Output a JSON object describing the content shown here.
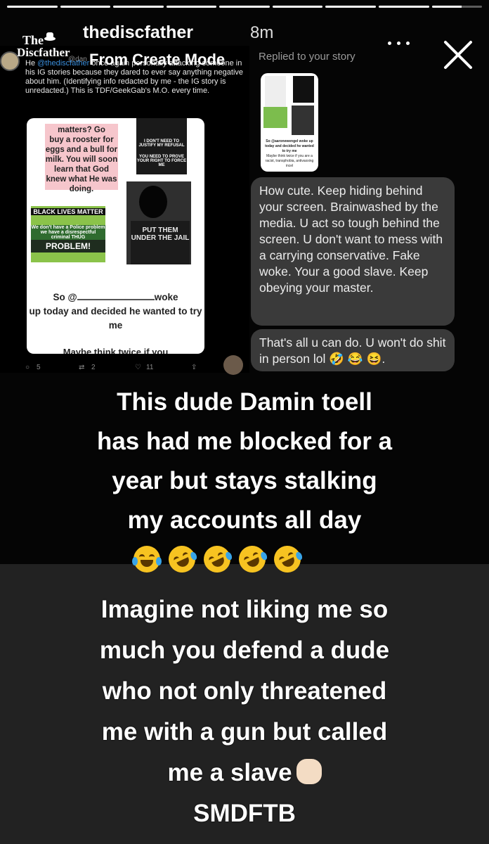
{
  "progress": {
    "segments": [
      1,
      1,
      1,
      1,
      1,
      1,
      1,
      1,
      0.6
    ]
  },
  "header": {
    "logo_line1": "The",
    "logo_line2": "Discfather",
    "username": "thediscfather",
    "time": "8m",
    "subtitle": "From Create Mode",
    "more_icon": "more-horizontal-icon",
    "close_icon": "close-icon"
  },
  "tweet": {
    "handle": "@dan",
    "text_prefix": "He ",
    "mention": "@thediscfather",
    "text_body": " once again personally attacking someone in his IG stories because they dared to ever say anything negative about him. (Identifying info redacted by me - the IG story is unredacted.) This is TDF/GeekGab's M.O. every time.",
    "note_top": "matters? Go",
    "note_text": "buy a rooster for eggs and a bull for milk. You will soon learn that God knew what He was doing.",
    "meme_text1": "I DON'T NEED TO JUSTIFY MY REFUSAL",
    "meme_text2": "YOU NEED TO PROVE YOUR RIGHT TO FORCE ME",
    "blm_title": "BLACK LIVES MATTER",
    "blm_sub": "We don't have a Police problem we have a disrespectful criminal THUG",
    "blm_problem": "PROBLEM!",
    "shirt_text": "PUT THEM UNDER THE JAIL",
    "caption_prefix": "So @",
    "caption_suffix": "woke",
    "caption_rest": "up today and decided he wanted to try me",
    "caption_cut": "Maybe think twice if you",
    "replies": "5",
    "retweets": "2",
    "likes": "11"
  },
  "dm": {
    "replied_label": "Replied to your story",
    "thumb_caption": "So @aaronewengel woke up today and decided he wanted to try me",
    "thumb_caption2": "Maybe think twice if you are a racist, transphobia, antivaxxing incel",
    "message1": "How cute. Keep hiding behind your screen. Brainwashed by the media. U act so tough behind the screen. U don't want to mess with a carrying conservative. Fake woke. Your a good slave. Keep obeying your master.",
    "message2": "That's all u can do. U won't do shit in person lol 🤣 😂 😆."
  },
  "overlay": {
    "line1": "This dude Damin toell",
    "line2": "has had me blocked for a",
    "line3": "year but stays stalking",
    "line4": "my accounts all day",
    "emojis": [
      "face-with-tears-of-joy-icon",
      "rolling-on-floor-laughing-icon",
      "rolling-on-floor-laughing-icon",
      "rolling-on-floor-laughing-icon",
      "rolling-on-floor-laughing-icon"
    ],
    "line5": "Imagine not liking me so",
    "line6": "much you defend a dude",
    "line7": "who not only threatened",
    "line8": "me with a gun but called",
    "line9": "me a slave",
    "clap_icon": "clapping-hands-icon",
    "line10": "SMDFTB"
  }
}
